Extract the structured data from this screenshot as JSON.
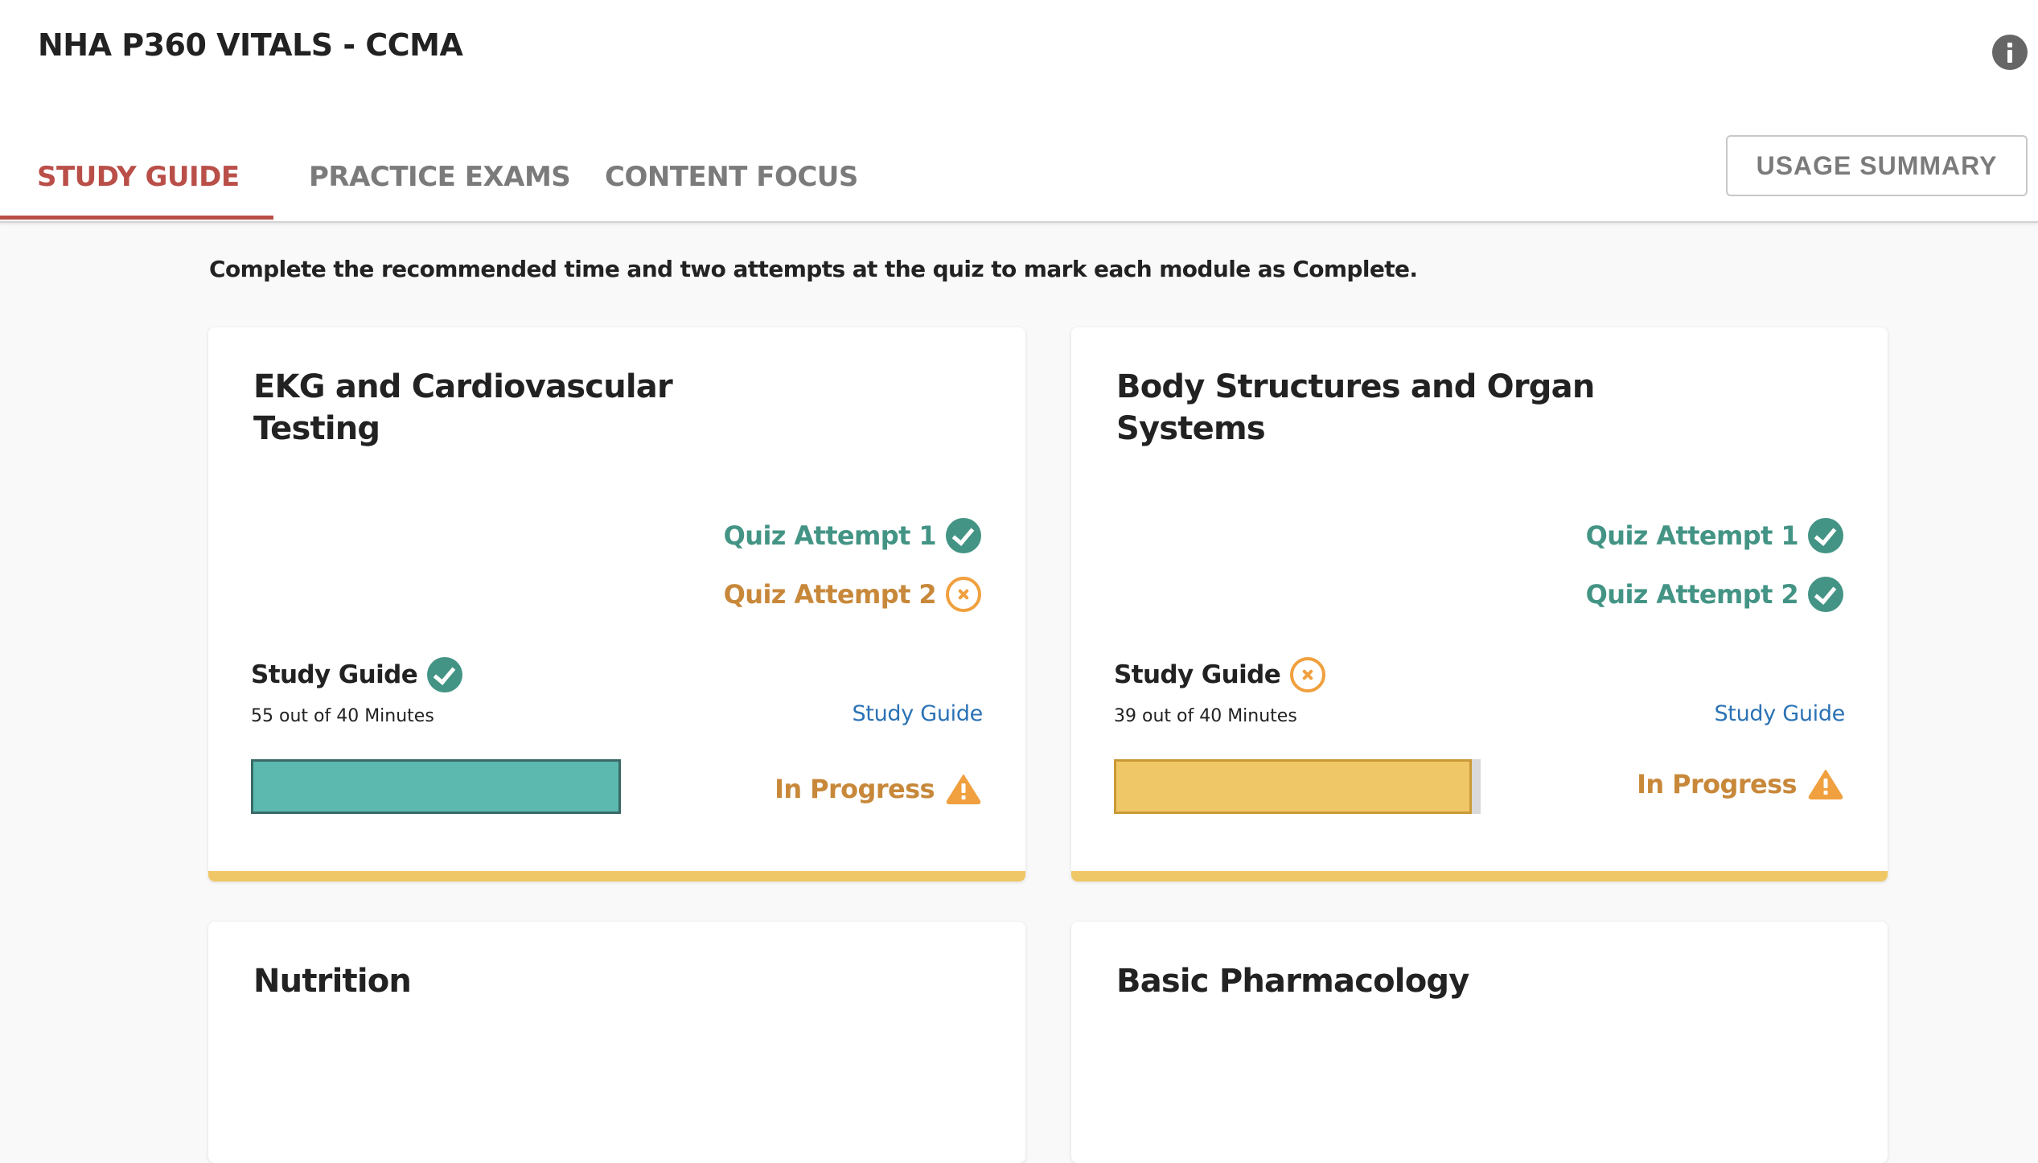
{
  "header": {
    "title": "NHA P360 VITALS - CCMA",
    "info_icon": "info-icon"
  },
  "tabs": [
    {
      "label": "STUDY GUIDE",
      "active": true
    },
    {
      "label": "PRACTICE EXAMS",
      "active": false
    },
    {
      "label": "CONTENT FOCUS",
      "active": false
    }
  ],
  "usage_summary_label": "USAGE SUMMARY",
  "instructions": "Complete the recommended time and two attempts at the quiz to mark each module as Complete.",
  "colors": {
    "accent": "#b94f48",
    "pass": "#439485",
    "fail": "#f0a03e",
    "in_progress_text": "#c8883a",
    "link": "#2b72b5",
    "band": "#f0c766"
  },
  "modules": [
    {
      "title": "EKG and Cardiovascular Testing",
      "quiz_attempts": [
        {
          "label": "Quiz Attempt 1",
          "status": "pass",
          "icon": "check-circle-icon"
        },
        {
          "label": "Quiz Attempt 2",
          "status": "fail",
          "icon": "x-circle-icon"
        }
      ],
      "study_guide_label": "Study Guide",
      "study_guide_status": "pass",
      "minutes_text": "55 out of 40 Minutes",
      "minutes_done": 55,
      "minutes_required": 40,
      "progress_fraction": 1.0,
      "bar_color": "#5cb9b0",
      "bar_border": "#3a6a66",
      "link_label": "Study Guide",
      "status_label": "In Progress",
      "status_icon": "warning-icon"
    },
    {
      "title": "Body Structures and Organ Systems",
      "quiz_attempts": [
        {
          "label": "Quiz Attempt 1",
          "status": "pass",
          "icon": "check-circle-icon"
        },
        {
          "label": "Quiz Attempt 2",
          "status": "pass",
          "icon": "check-circle-icon"
        }
      ],
      "study_guide_label": "Study Guide",
      "study_guide_status": "fail",
      "minutes_text": "39 out of 40 Minutes",
      "minutes_done": 39,
      "minutes_required": 40,
      "progress_fraction": 0.975,
      "bar_color": "#f0c766",
      "bar_border": "#c99a37",
      "link_label": "Study Guide",
      "status_label": "In Progress",
      "status_icon": "warning-icon"
    },
    {
      "title": "Nutrition"
    },
    {
      "title": "Basic Pharmacology"
    }
  ]
}
